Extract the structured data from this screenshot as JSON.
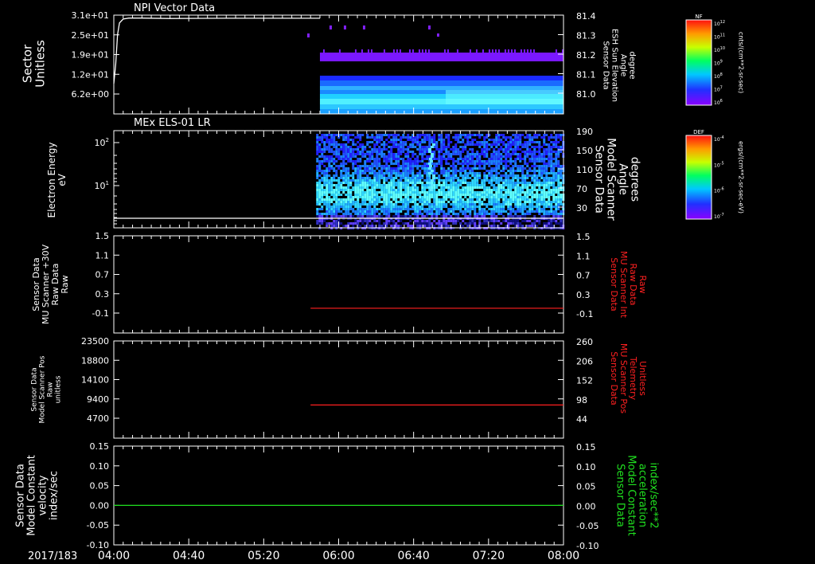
{
  "chart_data": {
    "type": "multi-panel-spectrogram",
    "date_label": "2017/183",
    "x_axis": {
      "start": "04:00",
      "end": "08:00",
      "ticks": [
        "04:00",
        "04:40",
        "05:20",
        "06:00",
        "06:40",
        "07:20",
        "08:00"
      ]
    },
    "panels": [
      {
        "id": "npi",
        "type": "spectrogram",
        "title": "NPI Vector Data",
        "ylabel_left": [
          "Sector",
          "Unitless"
        ],
        "ylabel_right": [
          "Sensor Data",
          "ESH Sun Elevation",
          "Angle",
          "degree"
        ],
        "y_ticks_left": [
          "3.1e+01",
          "2.5e+01",
          "1.9e+01",
          "1.2e+01",
          "6.2e+00"
        ],
        "y_ticks_right": [
          "81.4",
          "81.3",
          "81.2",
          "81.1",
          "81.0"
        ],
        "colorbar": {
          "label": "NF",
          "units": "cnts/(cm**2-sr-sec)",
          "ticks": [
            "10^12",
            "10^11",
            "10^10",
            "10^9",
            "10^8",
            "10^7",
            "10^6"
          ]
        },
        "data_start": "05:50",
        "line_overlay": {
          "color": "#ffffff",
          "x": [
            "04:00",
            "04:01",
            "04:02",
            "04:03",
            "04:05",
            "04:08",
            "04:15",
            "04:30",
            "05:00",
            "05:30",
            "05:50"
          ],
          "y": [
            81.05,
            81.15,
            81.3,
            81.36,
            81.38,
            81.385,
            81.385,
            81.383,
            81.384,
            81.384,
            81.384
          ]
        }
      },
      {
        "id": "els",
        "type": "spectrogram",
        "title": "MEx ELS-01 LR",
        "ylabel_left": [
          "Electron Energy",
          "eV"
        ],
        "ylabel_right": [
          "Sensor Data",
          "Model Scanner",
          "Angle",
          "degrees"
        ],
        "y_ticks_left": [
          "10^2",
          "10^1"
        ],
        "y_ticks_right": [
          "190",
          "150",
          "110",
          "70",
          "30"
        ],
        "colorbar": {
          "label": "DEF",
          "units": "ergs/(cm**2-sr-sec-eV)",
          "ticks": [
            "10^-4",
            "10^-5",
            "10^-6",
            "10^-7"
          ]
        },
        "data_start": "05:48",
        "line_overlay": {
          "color": "#ffffff",
          "value_deg": 20
        }
      },
      {
        "id": "mu-int",
        "type": "line",
        "ylabel_left": [
          "Sensor Data",
          "MU Scanner +30V",
          "Raw Data",
          "Raw"
        ],
        "ylabel_right": [
          "Sensor Data",
          "MU Scanner Int",
          "Raw Data",
          "Raw"
        ],
        "y_ticks_left": [
          "1.5",
          "1.1",
          "0.7",
          "0.3",
          "-0.1"
        ],
        "y_ticks_right": [
          "1.5",
          "1.1",
          "0.7",
          "0.3",
          "-0.1"
        ],
        "ylim": [
          -0.3,
          1.5
        ],
        "series": [
          {
            "color": "#ff2020",
            "x": [
              "05:45",
              "08:00"
            ],
            "y": [
              0,
              0
            ]
          }
        ]
      },
      {
        "id": "mu-pos",
        "type": "line",
        "ylabel_left": [
          "Sensor Data",
          "Model Scanner Pos",
          "Raw",
          "unitless"
        ],
        "ylabel_right": [
          "Sensor Data",
          "MU Scanner Pos",
          "Telemetry",
          "Unitless"
        ],
        "y_ticks_left": [
          "23500",
          "18800",
          "14100",
          "9400",
          "4700"
        ],
        "y_ticks_right": [
          "260",
          "206",
          "152",
          "98",
          "44"
        ],
        "ylim_left": [
          0,
          23500
        ],
        "ylim_right": [
          0,
          260
        ],
        "series": [
          {
            "color": "#ff2020",
            "x": [
              "05:45",
              "08:00"
            ],
            "y_right": [
              90,
              90
            ]
          }
        ]
      },
      {
        "id": "model",
        "type": "line",
        "ylabel_left": [
          "Sensor Data",
          "Model Constant",
          "velocity",
          "index/sec"
        ],
        "ylabel_right": [
          "Sensor Data",
          "Model Constant",
          "acceleration",
          "index/sec**2"
        ],
        "y_ticks_left": [
          "0.15",
          "0.10",
          "0.05",
          "0.00",
          "-0.05",
          "-0.10"
        ],
        "y_ticks_right": [
          "0.15",
          "0.10",
          "0.05",
          "0.00",
          "-0.05",
          "-0.10"
        ],
        "ylim": [
          -0.1,
          0.15
        ],
        "series": [
          {
            "color": "#20e020",
            "x": [
              "04:00",
              "08:00"
            ],
            "y": [
              0,
              0
            ]
          }
        ]
      }
    ]
  }
}
